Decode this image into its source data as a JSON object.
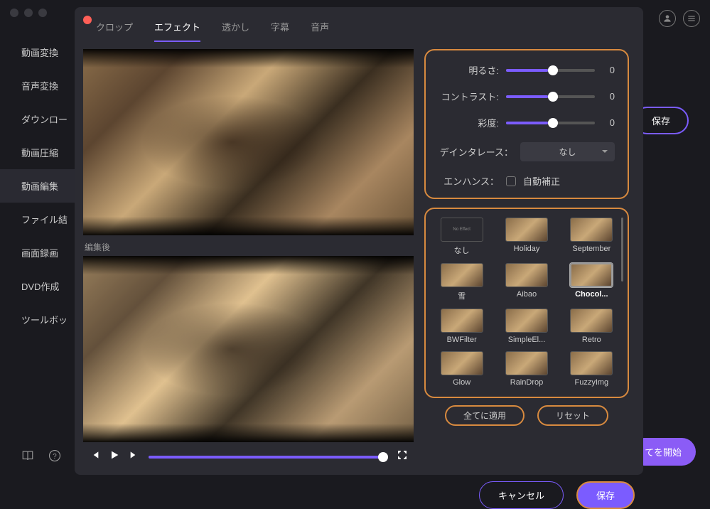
{
  "sidebar": {
    "items": [
      {
        "label": "動画変換"
      },
      {
        "label": "音声変換"
      },
      {
        "label": "ダウンロー"
      },
      {
        "label": "動画圧縮"
      },
      {
        "label": "動画編集",
        "active": true
      },
      {
        "label": "ファイル結"
      },
      {
        "label": "画面録画"
      },
      {
        "label": "DVD作成"
      },
      {
        "label": "ツールボッ"
      }
    ]
  },
  "bg": {
    "save": "保存",
    "start": "てを開始"
  },
  "tabs": [
    {
      "label": "クロップ"
    },
    {
      "label": "エフェクト",
      "active": true
    },
    {
      "label": "透かし"
    },
    {
      "label": "字幕"
    },
    {
      "label": "音声"
    }
  ],
  "preview_after_label": "編集後",
  "controls": {
    "brightness": {
      "label": "明るさ:",
      "value": 0,
      "pct": 47
    },
    "contrast": {
      "label": "コントラスト:",
      "value": 0,
      "pct": 47
    },
    "saturation": {
      "label": "彩度:",
      "value": 0,
      "pct": 47
    },
    "deinterlace": {
      "label": "デインタレース：",
      "value": "なし"
    },
    "enhance": {
      "label": "エンハンス：",
      "option": "自動補正"
    }
  },
  "effects": [
    {
      "name": "なし",
      "none": true
    },
    {
      "name": "Holiday"
    },
    {
      "name": "September"
    },
    {
      "name": "雪"
    },
    {
      "name": "Aibao"
    },
    {
      "name": "Chocol...",
      "selected": true
    },
    {
      "name": "BWFilter"
    },
    {
      "name": "SimpleEl..."
    },
    {
      "name": "Retro"
    },
    {
      "name": "Glow"
    },
    {
      "name": "RainDrop"
    },
    {
      "name": "FuzzyImg"
    }
  ],
  "actions": {
    "apply_all": "全てに適用",
    "reset": "リセット"
  },
  "footer": {
    "cancel": "キャンセル",
    "save": "保存"
  },
  "no_effect_text": "No Effect"
}
